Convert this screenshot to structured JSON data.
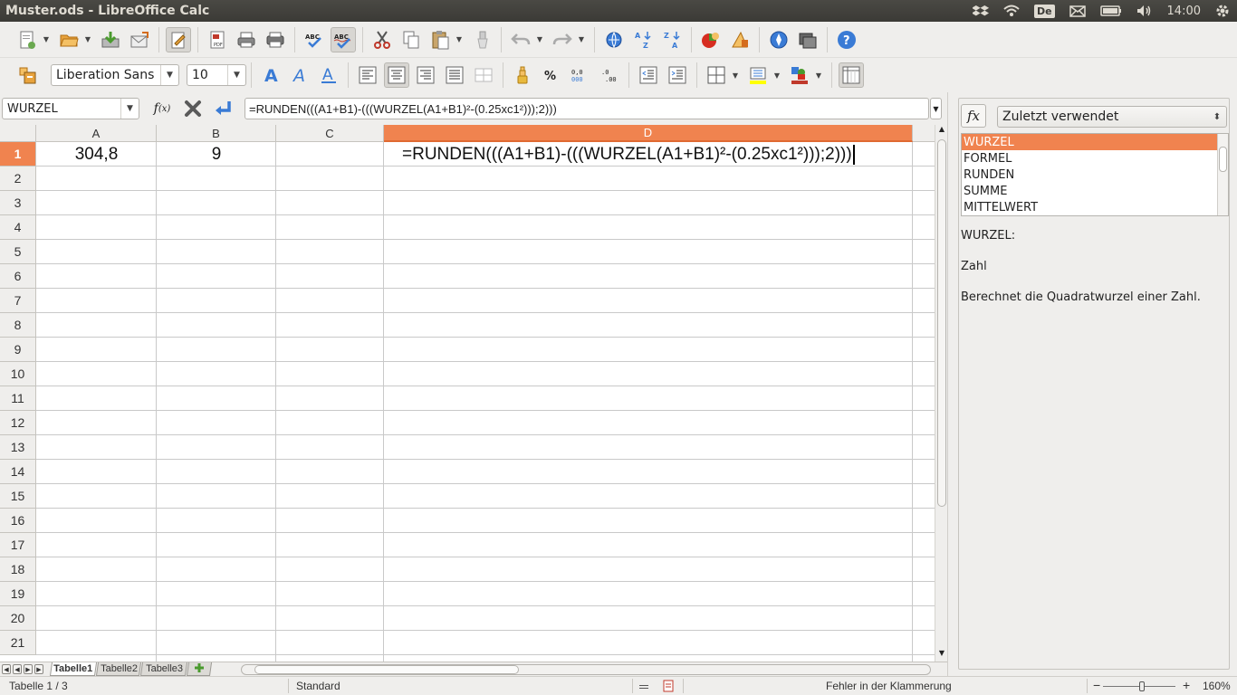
{
  "window": {
    "title": "Muster.ods - LibreOffice Calc"
  },
  "system_tray": {
    "keyboard": "De",
    "time": "14:00"
  },
  "font_toolbar": {
    "font_name": "Liberation Sans",
    "font_size": "10"
  },
  "formula_bar": {
    "name_box": "WURZEL",
    "formula": "=RUNDEN(((A1+B1)-(((WURZEL(A1+B1)²-(0.25xc1²)));2)))"
  },
  "grid": {
    "columns": [
      "A",
      "B",
      "C",
      "D"
    ],
    "active_column": "D",
    "rows": [
      "1",
      "2",
      "3",
      "4",
      "5",
      "6",
      "7",
      "8",
      "9",
      "10",
      "11",
      "12",
      "13",
      "14",
      "15",
      "16",
      "17",
      "18",
      "19",
      "20",
      "21"
    ],
    "active_row": "1",
    "cells": {
      "A1": "304,8",
      "B1": "9",
      "D1_edit": "=RUNDEN(((A1+B1)-(((WURZEL(A1+B1)²-(0.25xc1²)));2)))"
    }
  },
  "sheet_tabs": [
    "Tabelle1",
    "Tabelle2",
    "Tabelle3"
  ],
  "active_sheet": "Tabelle1",
  "status_bar": {
    "sheet_info": "Tabelle 1 / 3",
    "page_style": "Standard",
    "message": "Fehler in der Klammerung",
    "zoom": "160%"
  },
  "sidebar": {
    "fx_label": "fx",
    "category": "Zuletzt verwendet",
    "functions": [
      "WURZEL",
      "FORMEL",
      "RUNDEN",
      "SUMME",
      "MITTELWERT"
    ],
    "selected_function": "WURZEL",
    "description": {
      "signature": "WURZEL:",
      "argument": "Zahl",
      "text": "Berechnet die Quadratwurzel einer Zahl."
    }
  },
  "colors": {
    "accent": "#f0834f",
    "topbar": "#3b3a36"
  }
}
